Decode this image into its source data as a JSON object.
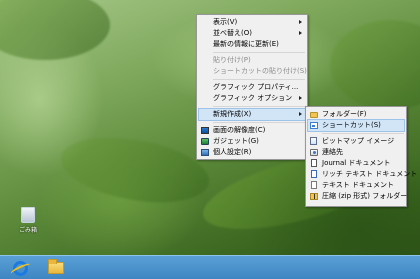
{
  "desktop": {
    "recycle_bin_label": "ごみ箱"
  },
  "context_menu": {
    "items": [
      {
        "label": "表示(V)",
        "has_submenu": true,
        "disabled": false
      },
      {
        "label": "並べ替え(O)",
        "has_submenu": true,
        "disabled": false
      },
      {
        "label": "最新の情報に更新(E)",
        "has_submenu": false,
        "disabled": false
      },
      {
        "label": "貼り付け(P)",
        "has_submenu": false,
        "disabled": true
      },
      {
        "label": "ショートカットの貼り付け(S)",
        "has_submenu": false,
        "disabled": true
      },
      {
        "label": "グラフィック プロパティ...",
        "has_submenu": false,
        "disabled": false
      },
      {
        "label": "グラフィック オプション",
        "has_submenu": true,
        "disabled": false
      },
      {
        "label": "新規作成(X)",
        "has_submenu": true,
        "disabled": false,
        "selected": true
      },
      {
        "label": "画面の解像度(C)",
        "icon": "display-icon"
      },
      {
        "label": "ガジェット(G)",
        "icon": "gadget-icon"
      },
      {
        "label": "個人設定(R)",
        "icon": "personalize-icon"
      }
    ]
  },
  "new_submenu": {
    "items": [
      {
        "label": "フォルダー(F)",
        "icon": "folder-icon"
      },
      {
        "label": "ショートカット(S)",
        "icon": "shortcut-icon",
        "selected": true
      },
      {
        "label": "ビットマップ イメージ",
        "icon": "bitmap-icon"
      },
      {
        "label": "連絡先",
        "icon": "contact-icon"
      },
      {
        "label": "Journal ドキュメント",
        "icon": "journal-icon"
      },
      {
        "label": "リッチ テキスト ドキュメント",
        "icon": "rtf-icon"
      },
      {
        "label": "テキスト ドキュメント",
        "icon": "text-file-icon"
      },
      {
        "label": "圧縮 (zip 形式) フォルダー",
        "icon": "zip-folder-icon"
      }
    ]
  },
  "taskbar": {
    "pinned": [
      "internet-explorer-icon",
      "file-explorer-icon"
    ]
  },
  "colors": {
    "menu_bg": "#f0f0f0",
    "selection": "#d1e5f7",
    "taskbar": "#4a92cc"
  }
}
